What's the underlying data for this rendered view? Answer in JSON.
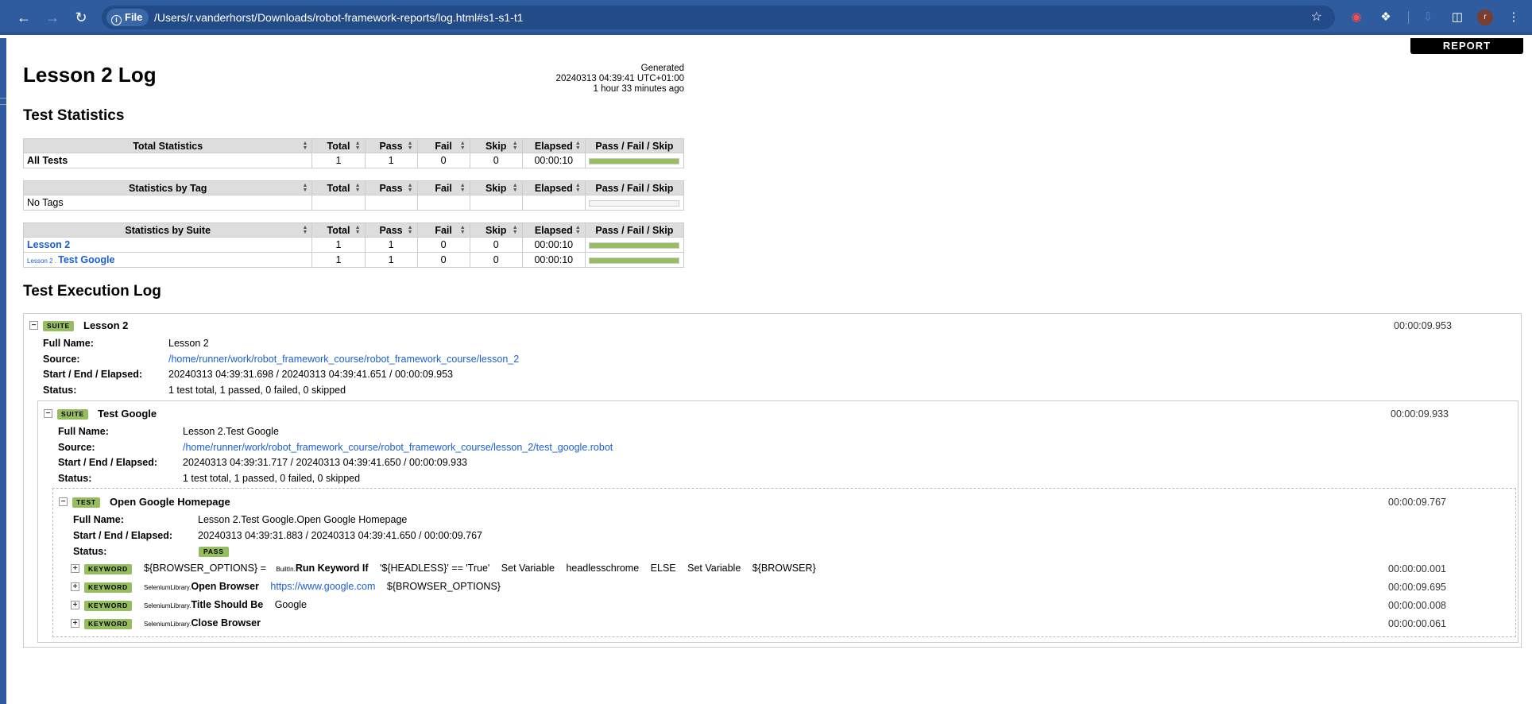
{
  "browser": {
    "url_chip": "File",
    "url": "/Users/r.vanderhorst/Downloads/robot-framework-reports/log.html#s1-s1-t1",
    "avatar_letter": "r"
  },
  "report_link": "REPORT",
  "page": {
    "title": "Lesson 2 Log",
    "generated_label": "Generated",
    "generated_timestamp": "20240313 04:39:41 UTC+01:00",
    "generated_ago": "1 hour 33 minutes ago"
  },
  "statistics": {
    "title": "Test Statistics",
    "columns": [
      "Total",
      "Pass",
      "Fail",
      "Skip",
      "Elapsed",
      "Pass / Fail / Skip"
    ],
    "total": {
      "header": "Total Statistics",
      "rows": [
        {
          "name": "All Tests",
          "total": "1",
          "pass": "1",
          "fail": "0",
          "skip": "0",
          "elapsed": "00:00:10",
          "pass_ratio": 1
        }
      ]
    },
    "tag": {
      "header": "Statistics by Tag",
      "rows": [
        {
          "name": "No Tags",
          "total": "",
          "pass": "",
          "fail": "",
          "skip": "",
          "elapsed": "",
          "pass_ratio": 0
        }
      ]
    },
    "suite": {
      "header": "Statistics by Suite",
      "rows": [
        {
          "prefix": "",
          "name": "Lesson 2",
          "total": "1",
          "pass": "1",
          "fail": "0",
          "skip": "0",
          "elapsed": "00:00:10",
          "pass_ratio": 1
        },
        {
          "prefix": "Lesson 2 . ",
          "name": "Test Google",
          "total": "1",
          "pass": "1",
          "fail": "0",
          "skip": "0",
          "elapsed": "00:00:10",
          "pass_ratio": 1
        }
      ]
    }
  },
  "log": {
    "title": "Test Execution Log",
    "labels": {
      "full_name": "Full Name:",
      "source": "Source:",
      "times": "Start / End / Elapsed:",
      "status": "Status:"
    },
    "suite1": {
      "type": "SUITE",
      "name": "Lesson 2",
      "elapsed": "00:00:09.953",
      "full_name": "Lesson 2",
      "source": "/home/runner/work/robot_framework_course/robot_framework_course/lesson_2",
      "times": "20240313 04:39:31.698 / 20240313 04:39:41.651 / 00:00:09.953",
      "status": "1 test total, 1 passed, 0 failed, 0 skipped"
    },
    "suite2": {
      "type": "SUITE",
      "name": "Test Google",
      "elapsed": "00:00:09.933",
      "full_name": "Lesson 2.Test Google",
      "source": "/home/runner/work/robot_framework_course/robot_framework_course/lesson_2/test_google.robot",
      "times": "20240313 04:39:31.717 / 20240313 04:39:41.650 / 00:00:09.933",
      "status": "1 test total, 1 passed, 0 failed, 0 skipped"
    },
    "test": {
      "type": "TEST",
      "name": "Open Google Homepage",
      "elapsed": "00:00:09.767",
      "full_name": "Lesson 2.Test Google.Open Google Homepage",
      "times": "20240313 04:39:31.883 / 20240313 04:39:41.650 / 00:00:09.767",
      "status": "PASS"
    },
    "keyword_badge": "KEYWORD",
    "keywords": [
      {
        "assign": "${BROWSER_OPTIONS} =",
        "lib": "BuiltIn",
        "name": "Run Keyword If",
        "args": [
          "'${HEADLESS}' == 'True'",
          "Set Variable",
          "headlesschrome",
          "ELSE",
          "Set Variable",
          "${BROWSER}"
        ],
        "elapsed": "00:00:00.001"
      },
      {
        "lib": "SeleniumLibrary",
        "name": "Open Browser",
        "link": "https://www.google.com",
        "args": [
          "${BROWSER_OPTIONS}"
        ],
        "elapsed": "00:00:09.695"
      },
      {
        "lib": "SeleniumLibrary",
        "name": "Title Should Be",
        "args": [
          "Google"
        ],
        "elapsed": "00:00:00.008"
      },
      {
        "lib": "SeleniumLibrary",
        "name": "Close Browser",
        "args": [],
        "elapsed": "00:00:00.061"
      }
    ]
  }
}
